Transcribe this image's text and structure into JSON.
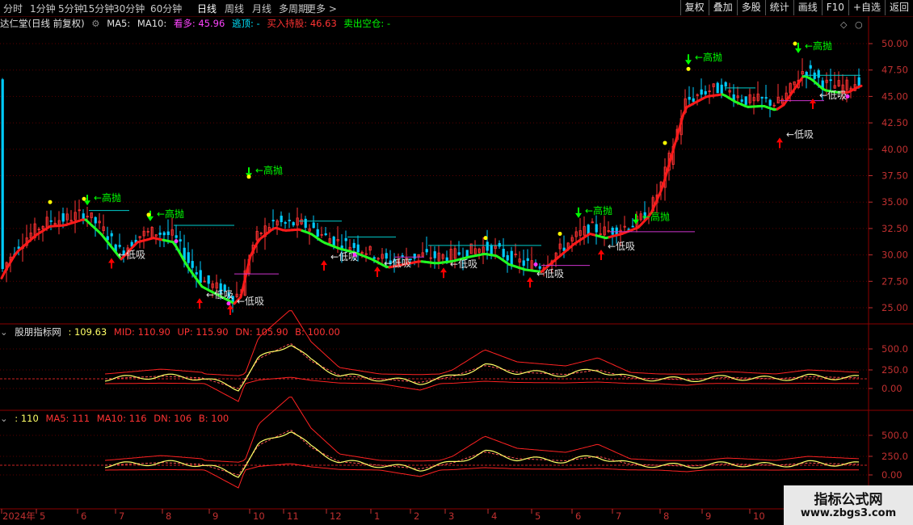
{
  "toolbar": {
    "periods": [
      "分时",
      "1分钟",
      "5分钟",
      "15分钟",
      "30分钟",
      "60分钟",
      "日线",
      "周线",
      "月线",
      "多周期",
      "更多 >"
    ],
    "active_period": "日线",
    "right_buttons": [
      "复权",
      "叠加",
      "多股",
      "统计",
      "画线",
      "F10",
      "+自选",
      "返回"
    ]
  },
  "main_info": {
    "title": "达仁堂(日线 前复权)",
    "ma5_label": "MA5:",
    "ma10_label": "MA10:",
    "kanduo": "看多: 45.96",
    "taoding": "逃顶: -",
    "mairu": "买入持股: 46.63",
    "maichu": "卖出空仓: -"
  },
  "ind1_info": {
    "name": "股朋指标网",
    "value": ": 109.63",
    "mid": "MID: 110.90",
    "up": "UP: 115.90",
    "dn": "DN: 105.90",
    "b": "B: 100.00"
  },
  "ind2_info": {
    "value": ": 110",
    "ma5": "MA5: 111",
    "ma10": "MA10: 116",
    "dn": "DN: 106",
    "b": "B: 100"
  },
  "price_axis": [
    "50.00",
    "47.50",
    "45.00",
    "42.50",
    "40.00",
    "37.50",
    "35.00",
    "32.50",
    "30.00",
    "27.50",
    "25.00"
  ],
  "ind_axis": [
    "500.0",
    "250.0",
    "0.00"
  ],
  "ind2_axis": [
    "500.0",
    "250.0",
    "0.00"
  ],
  "date_axis": [
    "2024年",
    "5",
    "6",
    "7",
    "8",
    "9",
    "10",
    "11",
    "12",
    "1",
    "2",
    "3",
    "4",
    "5",
    "6",
    "7",
    "8",
    "9",
    "10"
  ],
  "signals": {
    "sell": "高抛",
    "buy": "低吸",
    "sell_color": "#00ff00",
    "buy_color": "#ff0000"
  },
  "colors": {
    "bull_line": "#ff1a1a",
    "bear_line": "#22ff22",
    "up_candle": "#ff3333",
    "down_candle": "#00ccff",
    "ind_line": "#ffff66",
    "band": "#ff2222"
  },
  "watermark": {
    "line1": "指标公式网",
    "line2": "www.zbgs3.com"
  }
}
